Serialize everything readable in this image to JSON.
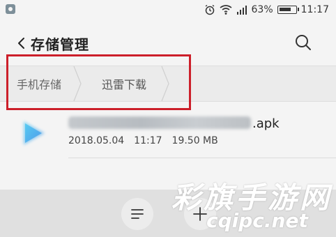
{
  "status_bar": {
    "battery_percent": "63%",
    "time": "11:17",
    "icons": [
      "app-icon",
      "alarm-icon",
      "wifi-icon",
      "signal-icon",
      "battery-icon"
    ]
  },
  "header": {
    "title": "存储管理",
    "icons": [
      "back-arrow-icon",
      "search-icon"
    ]
  },
  "breadcrumb": {
    "items": [
      {
        "label": "手机存储"
      },
      {
        "label": "迅雷下载"
      }
    ],
    "highlight_color": "#cc1f2a"
  },
  "files": [
    {
      "name_visible_suffix": ".apk",
      "date": "2018.05.04",
      "time": "11:17",
      "size": "19.50 MB",
      "icon": "apk-file-icon"
    }
  ],
  "toolbar": {
    "icons": [
      "menu-icon",
      "add-icon"
    ]
  },
  "watermark": {
    "line1": "彩旗手游网",
    "line2": "cqipc.net"
  }
}
